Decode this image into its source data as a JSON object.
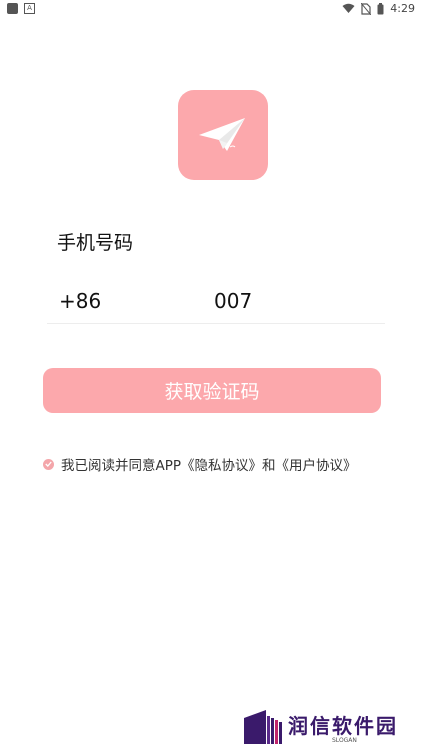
{
  "status_bar": {
    "time": "4:29",
    "icons": [
      "notification-square-icon",
      "keyboard-a-icon",
      "wifi-icon",
      "no-sim-icon",
      "battery-icon"
    ]
  },
  "logo": {
    "icon": "paper-plane-icon",
    "color": "#fca8ac"
  },
  "form": {
    "phone_label": "手机号码",
    "country_code": "+86",
    "phone_value": "007"
  },
  "button": {
    "label": "获取验证码",
    "color": "#fca8ac"
  },
  "agreement": {
    "prefix": "我已阅读并同意APP",
    "privacy_link": "《隐私协议》",
    "conjunction": "和",
    "user_link": "《用户协议》",
    "checked": true
  },
  "watermark": {
    "brand": "润信软件园",
    "slogan": "SLOGAN",
    "color": "#3a1a6b"
  }
}
